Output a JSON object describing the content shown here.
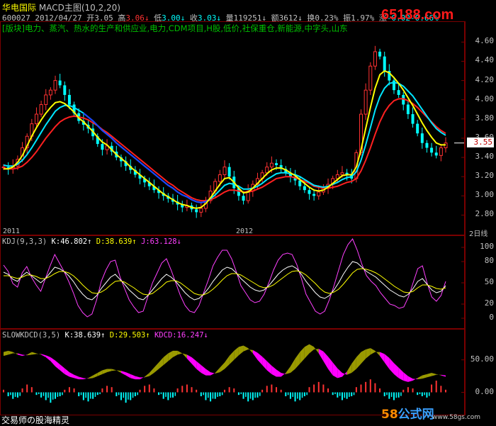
{
  "header": {
    "stock_name": "华电国际",
    "indicator_title": "MACD主图(10,2,20)",
    "code": "600027",
    "date": "2012/04/27",
    "open_label": "开",
    "open": "3.05",
    "high_label": "高",
    "high": "3.06",
    "low_label": "低",
    "low": "3.00",
    "close_label": "收",
    "close": "3.03",
    "volume_label": "量",
    "volume": "119251",
    "amount_label": "额",
    "amount": "3612",
    "turnover_label": "换",
    "turnover": "0.23%",
    "amplitude_label": "振",
    "amplitude": "1.97%",
    "change_label": "涨",
    "change": "-0.02",
    "change_pct": "-0.66%",
    "watermark": "65188.com",
    "sector_line": "[版块]电力、蒸汽、热水的生产和供应业,电力,CDM项目,H股,低价,社保重仓,新能源,中字头,山东"
  },
  "timeline": {
    "year_2011": "2011",
    "year_2012": "2012",
    "period": "2日线"
  },
  "kdj_header": {
    "name": "KDJ(9,3,3)",
    "k_label": "K:46.802",
    "d_label": "D:38.639",
    "j_label": "J:63.128"
  },
  "slow_header": {
    "name": "SLOWKDCD(3,5)",
    "k_label": "K:38.639",
    "d_label": "D:29.503",
    "kdcd_label": "KDCD:16.247"
  },
  "footer": {
    "brand": "交易师の股海精灵",
    "logo_58": "58",
    "logo_gs": "公式网",
    "site": "www.58gs.com"
  },
  "colors": {
    "up": "#ff3232",
    "down": "#00ffff",
    "ma_short": "#ffff00",
    "ma_mid": "#00e5ff",
    "ma_mid2": "#2040ff",
    "ma_long": "#ff2020",
    "kdj_k": "#ffffff",
    "kdj_d": "#ffff00",
    "kdj_j": "#ff40ff",
    "bull_fill": "#9a9a00",
    "bear_fill": "#ff00ff",
    "frame": "#7a0000"
  },
  "chart_data": [
    {
      "type": "candlestick",
      "title": "MACD主图(10,2,20)",
      "ylim": [
        2.7,
        4.75
      ],
      "y_ticks": [
        "4.60",
        "4.40",
        "4.20",
        "4.00",
        "3.80",
        "3.60",
        "3.40",
        "3.20",
        "3.00",
        "2.80"
      ],
      "y_tick_values": [
        4.6,
        4.4,
        4.2,
        4.0,
        3.8,
        3.6,
        3.4,
        3.2,
        3.0,
        2.8
      ],
      "current_price": "3.55",
      "current_price_value": 3.55,
      "x_labels": [
        "2011",
        "2012"
      ],
      "close": [
        3.3,
        3.28,
        3.31,
        3.38,
        3.5,
        3.62,
        3.75,
        3.85,
        3.95,
        4.05,
        4.1,
        4.2,
        4.15,
        4.05,
        3.95,
        3.86,
        3.78,
        3.74,
        3.7,
        3.62,
        3.54,
        3.48,
        3.52,
        3.46,
        3.4,
        3.36,
        3.31,
        3.27,
        3.22,
        3.18,
        3.14,
        3.1,
        3.06,
        3.03,
        3.0,
        2.97,
        2.94,
        2.91,
        2.88,
        2.9,
        2.86,
        2.83,
        2.87,
        2.95,
        3.05,
        3.15,
        3.22,
        3.3,
        3.2,
        3.08,
        3.0,
        2.95,
        3.05,
        3.12,
        3.18,
        3.24,
        3.3,
        3.34,
        3.32,
        3.28,
        3.24,
        3.2,
        3.16,
        3.1,
        3.06,
        3.02,
        3.0,
        3.04,
        3.08,
        3.12,
        3.18,
        3.22,
        3.24,
        3.22,
        3.18,
        3.45,
        3.85,
        4.1,
        4.35,
        4.5,
        4.45,
        4.3,
        4.2,
        4.1,
        4.05,
        3.95,
        3.85,
        3.75,
        3.65,
        3.55,
        3.5,
        3.45,
        3.42,
        3.5,
        3.55
      ],
      "ma_short": [
        3.28,
        3.28,
        3.3,
        3.35,
        3.42,
        3.52,
        3.62,
        3.71,
        3.79,
        3.86,
        3.92,
        3.97,
        3.98,
        3.96,
        3.92,
        3.87,
        3.81,
        3.77,
        3.72,
        3.67,
        3.61,
        3.56,
        3.53,
        3.48,
        3.43,
        3.39,
        3.35,
        3.3,
        3.26,
        3.22,
        3.18,
        3.14,
        3.1,
        3.06,
        3.02,
        2.99,
        2.96,
        2.93,
        2.91,
        2.9,
        2.88,
        2.87,
        2.88,
        2.92,
        2.98,
        3.05,
        3.12,
        3.18,
        3.19,
        3.14,
        3.08,
        3.03,
        3.04,
        3.08,
        3.13,
        3.18,
        3.23,
        3.27,
        3.29,
        3.29,
        3.27,
        3.24,
        3.21,
        3.17,
        3.13,
        3.09,
        3.06,
        3.05,
        3.06,
        3.09,
        3.13,
        3.17,
        3.21,
        3.22,
        3.22,
        3.3,
        3.48,
        3.7,
        3.92,
        4.12,
        4.26,
        4.3,
        4.28,
        4.23,
        4.17,
        4.1,
        4.02,
        3.94,
        3.85,
        3.76,
        3.68,
        3.61,
        3.55,
        3.53,
        3.53
      ],
      "ma_mid": [
        3.32,
        3.31,
        3.31,
        3.33,
        3.37,
        3.43,
        3.5,
        3.58,
        3.66,
        3.74,
        3.81,
        3.88,
        3.92,
        3.94,
        3.94,
        3.92,
        3.89,
        3.86,
        3.82,
        3.78,
        3.73,
        3.68,
        3.64,
        3.6,
        3.55,
        3.51,
        3.47,
        3.43,
        3.39,
        3.35,
        3.31,
        3.27,
        3.23,
        3.19,
        3.15,
        3.11,
        3.08,
        3.04,
        3.01,
        2.99,
        2.96,
        2.94,
        2.93,
        2.94,
        2.97,
        3.01,
        3.06,
        3.11,
        3.13,
        3.12,
        3.1,
        3.07,
        3.07,
        3.08,
        3.1,
        3.13,
        3.17,
        3.2,
        3.23,
        3.24,
        3.24,
        3.23,
        3.22,
        3.2,
        3.17,
        3.14,
        3.11,
        3.1,
        3.09,
        3.1,
        3.12,
        3.14,
        3.17,
        3.19,
        3.2,
        3.25,
        3.37,
        3.53,
        3.71,
        3.89,
        4.03,
        4.12,
        4.17,
        4.18,
        4.17,
        4.14,
        4.09,
        4.04,
        3.97,
        3.9,
        3.83,
        3.76,
        3.7,
        3.66,
        3.63
      ],
      "ma_long": [
        3.29,
        3.28,
        3.28,
        3.29,
        3.31,
        3.35,
        3.4,
        3.46,
        3.53,
        3.6,
        3.66,
        3.72,
        3.77,
        3.8,
        3.82,
        3.83,
        3.82,
        3.81,
        3.79,
        3.76,
        3.73,
        3.69,
        3.66,
        3.62,
        3.58,
        3.54,
        3.5,
        3.46,
        3.42,
        3.38,
        3.34,
        3.3,
        3.26,
        3.22,
        3.18,
        3.14,
        3.11,
        3.07,
        3.04,
        3.01,
        2.98,
        2.96,
        2.95,
        2.95,
        2.96,
        2.98,
        3.01,
        3.04,
        3.06,
        3.06,
        3.05,
        3.04,
        3.04,
        3.05,
        3.07,
        3.09,
        3.12,
        3.15,
        3.18,
        3.19,
        3.2,
        3.2,
        3.19,
        3.17,
        3.15,
        3.13,
        3.1,
        3.09,
        3.08,
        3.08,
        3.09,
        3.1,
        3.12,
        3.14,
        3.15,
        3.18,
        3.26,
        3.37,
        3.5,
        3.64,
        3.77,
        3.87,
        3.94,
        3.99,
        4.01,
        4.01,
        3.99,
        3.96,
        3.92,
        3.87,
        3.82,
        3.77,
        3.72,
        3.68,
        3.65
      ]
    },
    {
      "type": "line",
      "title": "KDJ(9,3,3)",
      "ylim": [
        -10,
        110
      ],
      "y_ticks": [
        "100",
        "80",
        "50",
        "20",
        "0"
      ],
      "y_tick_values": [
        100,
        80,
        50,
        20,
        0
      ],
      "series": [
        {
          "name": "K",
          "values": [
            65,
            62,
            55,
            52,
            60,
            65,
            60,
            55,
            50,
            56,
            64,
            72,
            70,
            66,
            60,
            52,
            42,
            34,
            28,
            26,
            32,
            42,
            50,
            58,
            62,
            55,
            48,
            40,
            34,
            28,
            26,
            32,
            40,
            48,
            56,
            62,
            58,
            52,
            44,
            36,
            30,
            26,
            28,
            34,
            42,
            52,
            60,
            68,
            72,
            70,
            64,
            56,
            50,
            44,
            40,
            38,
            40,
            46,
            54,
            62,
            68,
            72,
            74,
            70,
            62,
            52,
            44,
            36,
            30,
            28,
            32,
            40,
            50,
            62,
            72,
            80,
            78,
            72,
            66,
            62,
            58,
            52,
            46,
            40,
            36,
            32,
            30,
            34,
            42,
            52,
            56,
            48,
            40,
            36,
            38,
            46
          ]
        },
        {
          "name": "D",
          "values": [
            60,
            60,
            58,
            56,
            58,
            61,
            61,
            59,
            56,
            56,
            59,
            63,
            66,
            66,
            64,
            60,
            54,
            47,
            41,
            36,
            35,
            37,
            41,
            47,
            52,
            53,
            51,
            47,
            43,
            38,
            34,
            33,
            35,
            40,
            45,
            51,
            53,
            53,
            50,
            45,
            40,
            35,
            33,
            33,
            36,
            41,
            47,
            54,
            60,
            63,
            63,
            61,
            57,
            53,
            49,
            45,
            43,
            44,
            47,
            52,
            57,
            62,
            66,
            67,
            65,
            61,
            55,
            49,
            42,
            37,
            35,
            37,
            41,
            48,
            56,
            64,
            69,
            70,
            69,
            67,
            64,
            60,
            55,
            50,
            45,
            41,
            37,
            36,
            38,
            43,
            47,
            47,
            45,
            42,
            41,
            43
          ]
        },
        {
          "name": "J",
          "values": [
            75,
            66,
            49,
            44,
            64,
            73,
            58,
            47,
            38,
            56,
            74,
            90,
            78,
            66,
            52,
            36,
            18,
            8,
            2,
            6,
            26,
            52,
            68,
            80,
            82,
            59,
            42,
            26,
            16,
            8,
            10,
            30,
            50,
            64,
            78,
            84,
            68,
            50,
            32,
            18,
            10,
            8,
            18,
            36,
            54,
            74,
            86,
            96,
            96,
            84,
            66,
            46,
            36,
            26,
            22,
            24,
            34,
            50,
            68,
            82,
            90,
            92,
            90,
            76,
            56,
            34,
            22,
            10,
            6,
            10,
            26,
            46,
            68,
            90,
            104,
            112,
            96,
            76,
            60,
            52,
            46,
            36,
            28,
            20,
            18,
            14,
            16,
            30,
            50,
            70,
            74,
            50,
            30,
            24,
            32,
            52
          ]
        }
      ]
    },
    {
      "type": "area",
      "title": "SLOWKDCD(3,5)",
      "ylim": [
        -30,
        90
      ],
      "y_ticks": [
        "50.00",
        "0.00"
      ],
      "y_tick_values": [
        50,
        0
      ],
      "series": [
        {
          "name": "K",
          "values": [
            62,
            64,
            62,
            58,
            56,
            58,
            62,
            60,
            58,
            54,
            48,
            40,
            34,
            28,
            24,
            22,
            20,
            20,
            22,
            26,
            30,
            34,
            36,
            36,
            34,
            30,
            26,
            22,
            20,
            20,
            24,
            30,
            38,
            46,
            54,
            60,
            64,
            64,
            60,
            52,
            44,
            36,
            30,
            26,
            26,
            30,
            38,
            46,
            56,
            64,
            70,
            72,
            68,
            60,
            50,
            42,
            34,
            28,
            24,
            24,
            30,
            40,
            52,
            62,
            70,
            74,
            70,
            60,
            48,
            36,
            26,
            22,
            24,
            32,
            44,
            54,
            62,
            66,
            68,
            64,
            56,
            46,
            36,
            28,
            22,
            18,
            16,
            18,
            22,
            26,
            28,
            30,
            28,
            26,
            24
          ]
        },
        {
          "name": "D",
          "values": [
            56,
            58,
            60,
            60,
            58,
            57,
            58,
            59,
            59,
            57,
            54,
            49,
            43,
            37,
            31,
            27,
            24,
            22,
            21,
            22,
            25,
            28,
            31,
            33,
            34,
            33,
            31,
            28,
            25,
            23,
            23,
            25,
            30,
            36,
            42,
            48,
            54,
            58,
            60,
            58,
            54,
            48,
            42,
            36,
            31,
            29,
            31,
            36,
            43,
            50,
            57,
            63,
            66,
            65,
            61,
            55,
            48,
            41,
            35,
            30,
            28,
            30,
            36,
            44,
            52,
            60,
            66,
            67,
            63,
            55,
            46,
            37,
            30,
            27,
            30,
            36,
            44,
            52,
            58,
            62,
            62,
            59,
            53,
            45,
            38,
            31,
            25,
            21,
            20,
            21,
            23,
            25,
            27,
            27,
            26
          ]
        }
      ],
      "bar_series": {
        "name": "KDCD",
        "values": [
          4,
          -6,
          -10,
          -8,
          6,
          12,
          8,
          -4,
          -8,
          -12,
          -16,
          -10,
          -6,
          4,
          8,
          6,
          -6,
          -12,
          -14,
          -10,
          -4,
          6,
          10,
          8,
          -6,
          -12,
          -16,
          -12,
          -6,
          4,
          10,
          12,
          6,
          -4,
          -10,
          -12,
          -8,
          6,
          10,
          12,
          8,
          4,
          -6,
          -12,
          -14,
          -10,
          -6,
          4,
          8,
          6,
          -4,
          -10,
          -14,
          -12,
          -8,
          4,
          10,
          12,
          8,
          4,
          -6,
          -10,
          -14,
          -12,
          -6,
          8,
          12,
          16,
          12,
          6,
          -4,
          -8,
          -12,
          -10,
          -6,
          8,
          12,
          16,
          20,
          14,
          6,
          -6,
          -10,
          -12,
          -8,
          4,
          8,
          6,
          -4,
          -6,
          -8,
          12,
          18,
          10,
          4
        ]
      }
    }
  ]
}
